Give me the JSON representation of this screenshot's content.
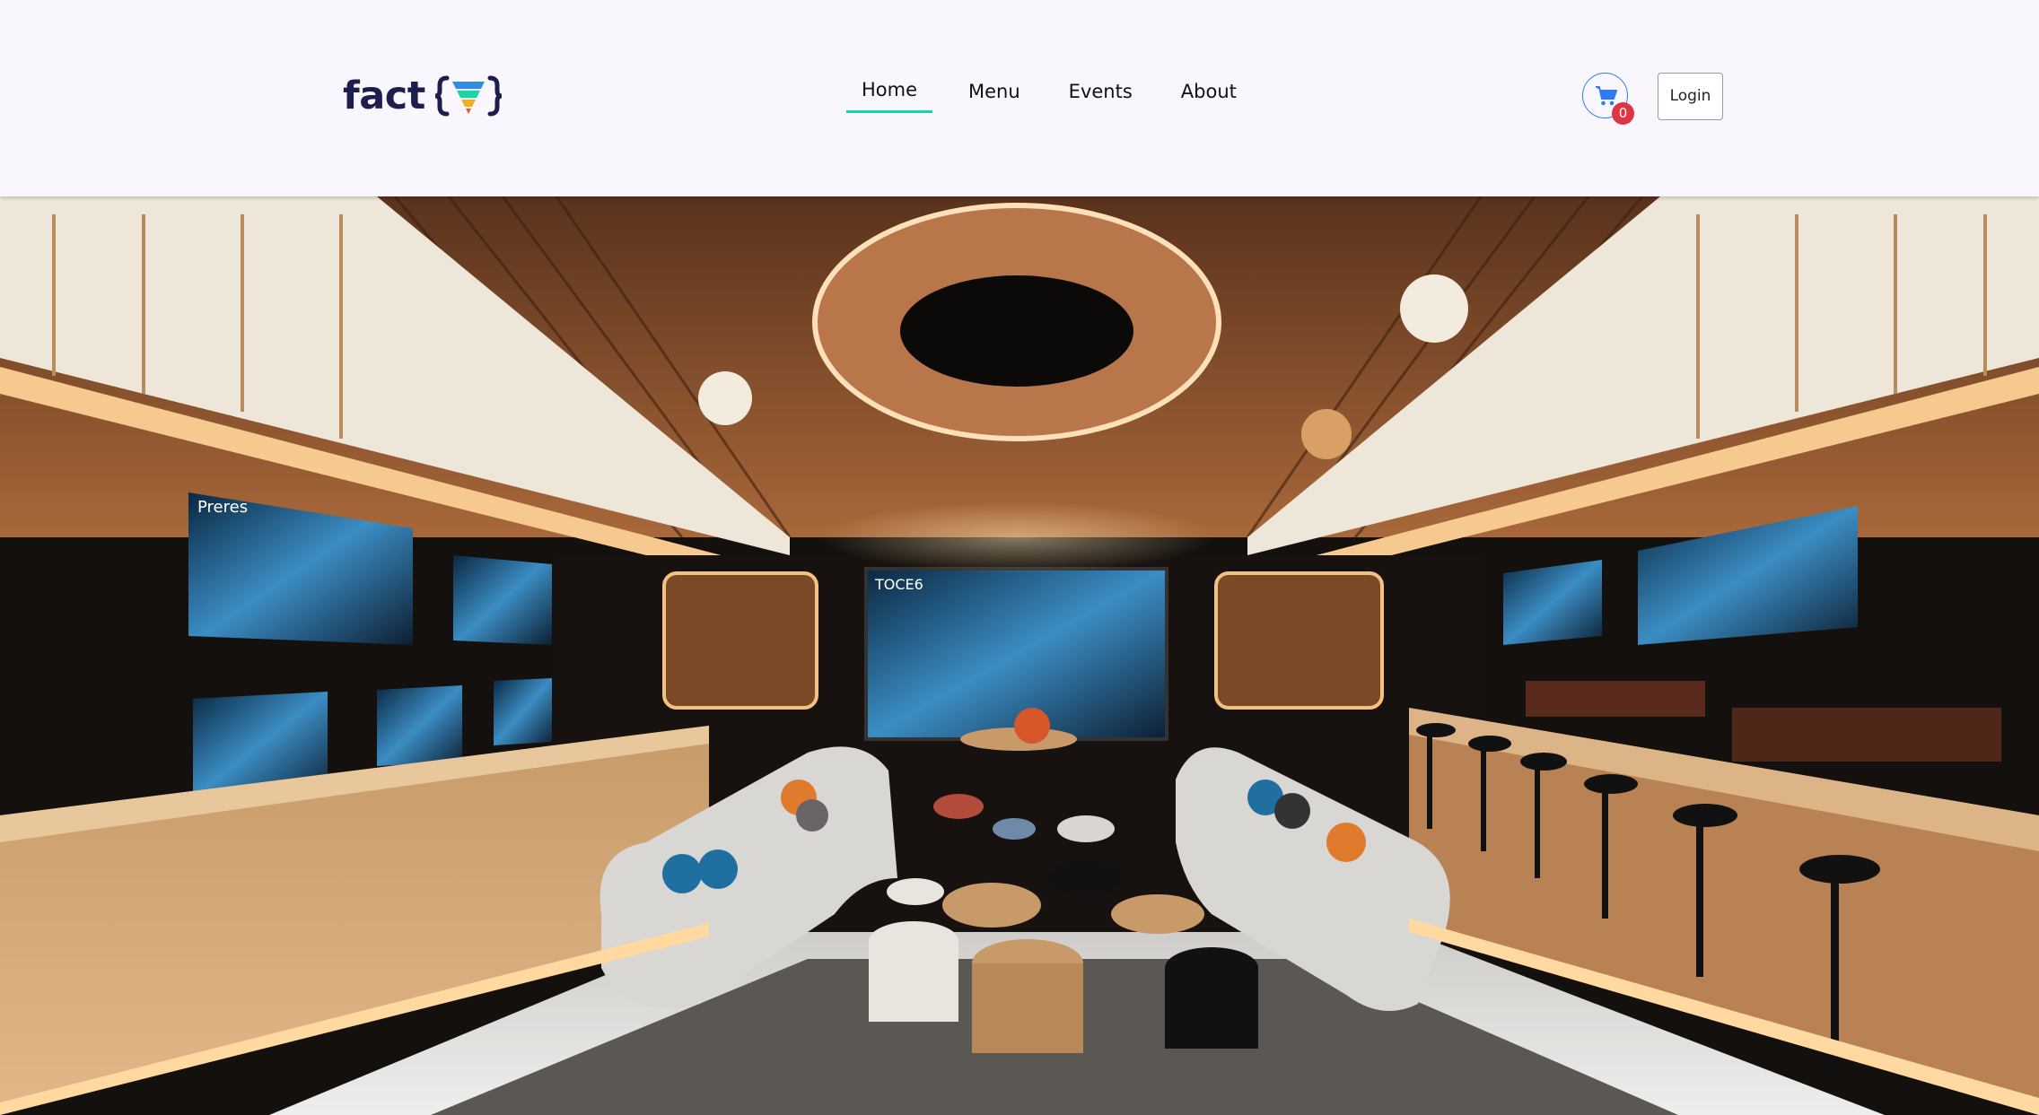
{
  "header": {
    "logo": {
      "text": "fact",
      "mark_icon": "bracket-v-mark-icon"
    },
    "nav": {
      "home": "Home",
      "menu": "Menu",
      "events": "Events",
      "about": "About"
    },
    "active_nav": "Home",
    "cart": {
      "icon": "cart-icon",
      "count": "0"
    },
    "login_label": "Login"
  },
  "hero": {
    "image": "lounge-interior-photo",
    "screen_text_left": "Preres",
    "screen_text_center": "TOCE6"
  },
  "colors": {
    "background": "#f9f7fd",
    "active_underline": "#14d6a6",
    "cart_border": "#2f7bf5",
    "badge": "#dc3545",
    "logo": "#1d1e4e"
  }
}
